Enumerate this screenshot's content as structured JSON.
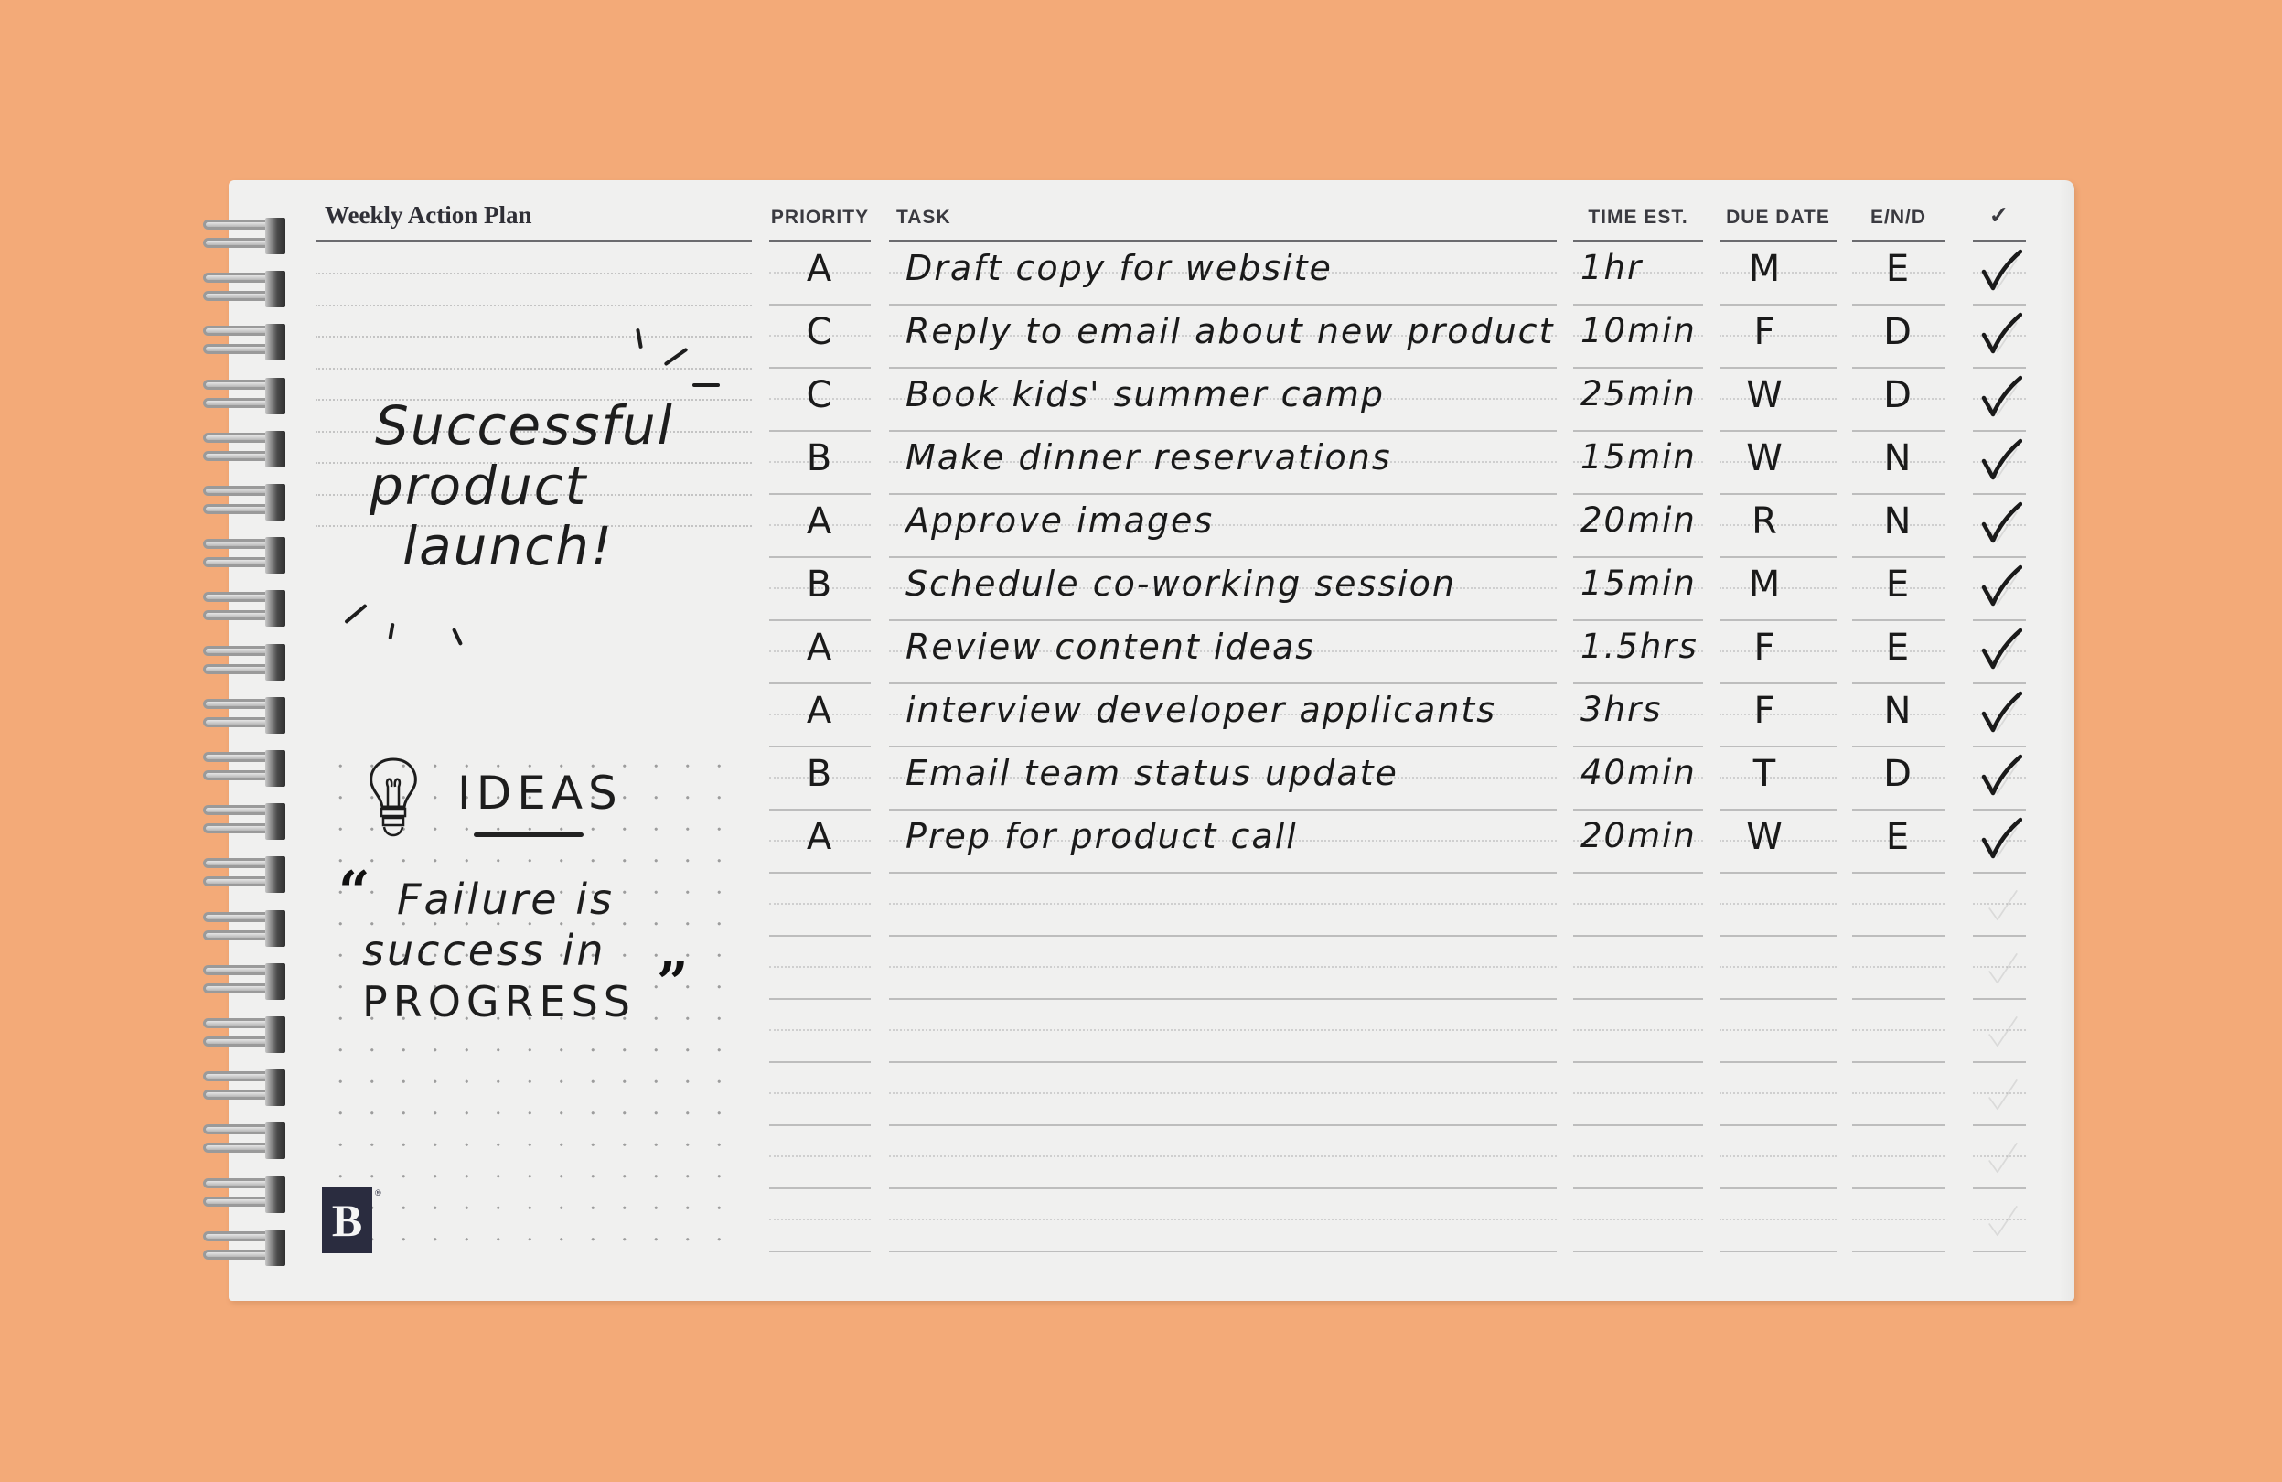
{
  "planner": {
    "title": "Weekly Action Plan",
    "brand_logo_letter": "B",
    "brand_logo_mark": "®",
    "columns": {
      "priority": "PRIORITY",
      "task": "TASK",
      "time_est": "TIME EST.",
      "due_date": "DUE DATE",
      "end": "E/N/D",
      "done": "✓"
    },
    "tasks": [
      {
        "priority": "A",
        "task": "Draft copy for website",
        "time_est": "1hr",
        "due_date": "M",
        "end": "E",
        "done": true
      },
      {
        "priority": "C",
        "task": "Reply to email about new product",
        "time_est": "10min",
        "due_date": "F",
        "end": "D",
        "done": true
      },
      {
        "priority": "C",
        "task": "Book kids' summer camp",
        "time_est": "25min",
        "due_date": "W",
        "end": "D",
        "done": true
      },
      {
        "priority": "B",
        "task": "Make dinner reservations",
        "time_est": "15min",
        "due_date": "W",
        "end": "N",
        "done": true
      },
      {
        "priority": "A",
        "task": "Approve images",
        "time_est": "20min",
        "due_date": "R",
        "end": "N",
        "done": true
      },
      {
        "priority": "B",
        "task": "Schedule co-working session",
        "time_est": "15min",
        "due_date": "M",
        "end": "E",
        "done": true
      },
      {
        "priority": "A",
        "task": "Review content ideas",
        "time_est": "1.5hrs",
        "due_date": "F",
        "end": "E",
        "done": true
      },
      {
        "priority": "A",
        "task": "interview developer applicants",
        "time_est": "3hrs",
        "due_date": "F",
        "end": "N",
        "done": true
      },
      {
        "priority": "B",
        "task": "Email team status update",
        "time_est": "40min",
        "due_date": "T",
        "end": "D",
        "done": true
      },
      {
        "priority": "A",
        "task": "Prep for product call",
        "time_est": "20min",
        "due_date": "W",
        "end": "E",
        "done": true
      }
    ],
    "empty_rows": 6
  },
  "notes": {
    "headline_lines": [
      "Successful",
      "product",
      "launch!"
    ],
    "ideas_label": "IDEAS",
    "ideas_icon": "lightbulb-icon",
    "quote_lines": [
      "Failure is",
      "success in",
      "PROGRESS"
    ],
    "quote_open": "“",
    "quote_close": "”"
  }
}
